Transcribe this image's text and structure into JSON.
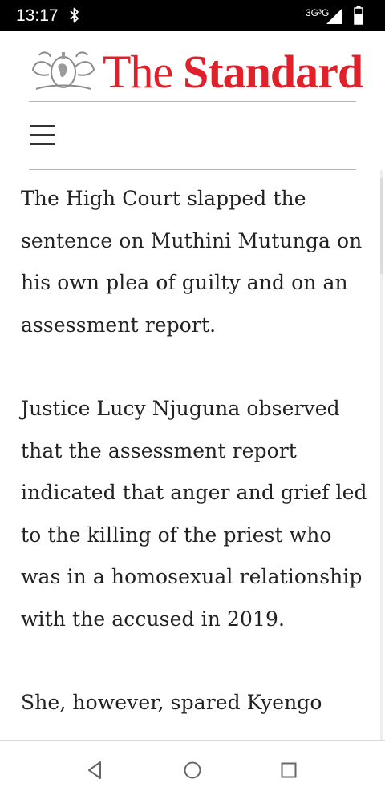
{
  "status_bar": {
    "time": "13:17",
    "network": "3G³G",
    "icons": [
      "bluetooth-icon",
      "signal-icon",
      "battery-icon"
    ]
  },
  "brand": {
    "logo": "crest-logo",
    "name_light": "The",
    "name_bold": "Standard",
    "color": "#e0202a"
  },
  "header": {
    "menu_icon": "hamburger-menu-icon"
  },
  "article": {
    "paragraphs": [
      "The High Court slapped the sentence on Muthini Mutunga on his own plea of guilty and on an assessment report.",
      "Justice Lucy Njuguna observed that the assessment report indicated that anger and grief led to the killing of the priest who was in a homosexual relationship with the accused in 2019.",
      "She, however, spared Kyengo"
    ],
    "text_color": "#222222"
  },
  "nav_bar": {
    "buttons": [
      "back-triangle-icon",
      "home-circle-icon",
      "recents-square-icon"
    ]
  }
}
